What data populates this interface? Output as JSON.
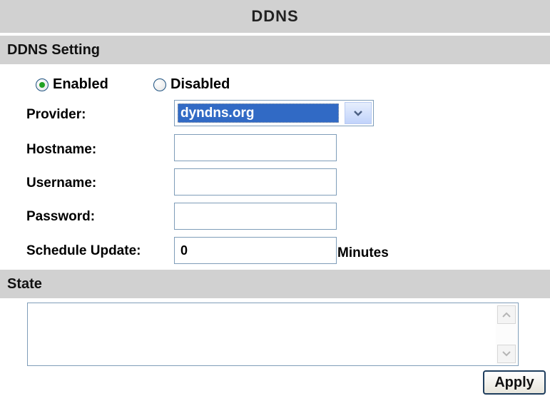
{
  "title": "DDNS",
  "ddns_setting": {
    "header": "DDNS Setting",
    "enabled_label": "Enabled",
    "disabled_label": "Disabled",
    "selected": "Enabled",
    "provider_label": "Provider:",
    "provider_value": "dyndns.org",
    "hostname_label": "Hostname:",
    "hostname_value": "",
    "username_label": "Username:",
    "username_value": "",
    "password_label": "Password:",
    "password_value": "",
    "schedule_label": "Schedule Update:",
    "schedule_value": "0",
    "schedule_unit": "Minutes"
  },
  "state": {
    "header": "State",
    "value": ""
  },
  "apply_label": "Apply",
  "icons": {
    "dropdown": "chevron-down-icon",
    "scroll_up": "scroll-up-arrow-icon",
    "scroll_down": "scroll-down-arrow-icon"
  },
  "colors": {
    "header_bg": "#d1d1d1",
    "selection": "#316ac5",
    "radio_dot": "#21a121",
    "input_border": "#7f9db9"
  }
}
